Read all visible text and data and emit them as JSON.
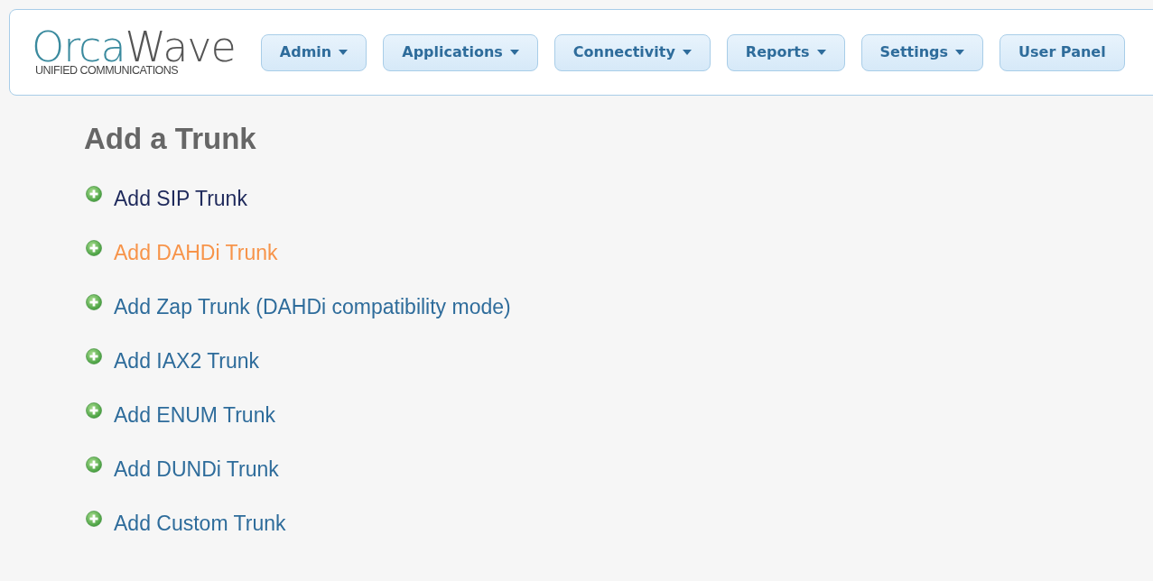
{
  "logo": {
    "primary": "Orca",
    "secondary": "Wave",
    "tagline": "UNIFIED COMMUNICATIONS"
  },
  "menu": [
    {
      "label": "Admin",
      "dropdown": true
    },
    {
      "label": "Applications",
      "dropdown": true
    },
    {
      "label": "Connectivity",
      "dropdown": true
    },
    {
      "label": "Reports",
      "dropdown": true
    },
    {
      "label": "Settings",
      "dropdown": true
    },
    {
      "label": "User Panel",
      "dropdown": false
    }
  ],
  "heading": "Add a Trunk",
  "links": [
    {
      "label": "Add SIP Trunk",
      "visited": true,
      "hovered": false
    },
    {
      "label": "Add DAHDi Trunk",
      "visited": false,
      "hovered": true
    },
    {
      "label": "Add Zap Trunk (DAHDi compatibility mode)",
      "visited": false,
      "hovered": false
    },
    {
      "label": "Add IAX2 Trunk",
      "visited": false,
      "hovered": false
    },
    {
      "label": "Add ENUM Trunk",
      "visited": false,
      "hovered": false
    },
    {
      "label": "Add DUNDi Trunk",
      "visited": false,
      "hovered": false
    },
    {
      "label": "Add Custom Trunk",
      "visited": false,
      "hovered": false
    }
  ]
}
